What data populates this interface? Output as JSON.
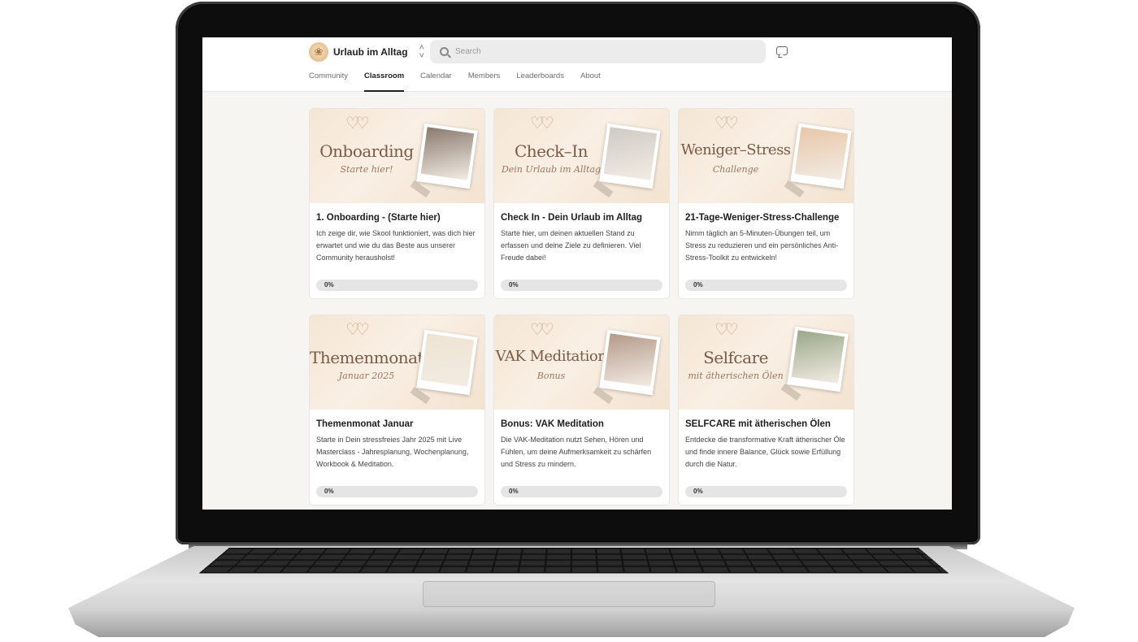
{
  "app": {
    "community_name": "Urlaub im Alltag",
    "search_placeholder": "Search"
  },
  "tabs": [
    {
      "label": "Community",
      "active": false
    },
    {
      "label": "Classroom",
      "active": true
    },
    {
      "label": "Calendar",
      "active": false
    },
    {
      "label": "Members",
      "active": false
    },
    {
      "label": "Leaderboards",
      "active": false
    },
    {
      "label": "About",
      "active": false
    }
  ],
  "courses": [
    {
      "cover_title": "Onboarding",
      "cover_subtitle": "Starte hier!",
      "title": "1. Onboarding - (Starte hier)",
      "description": "Ich zeige dir, wie Skool funktioniert, was dich hier erwartet und wie du das Beste aus unserer Community herausholst!",
      "progress": 0,
      "progress_label": "0%",
      "photo_color": "#8a7a6e"
    },
    {
      "cover_title": "Check–In",
      "cover_subtitle": "Dein Urlaub im Alltag",
      "title": "Check In - Dein Urlaub im Alltag",
      "description": "Starte hier, um deinen aktuellen Stand zu erfassen und deine Ziele zu definieren. Viel Freude dabei!",
      "progress": 0,
      "progress_label": "0%",
      "photo_color": "#cfcac4"
    },
    {
      "cover_title": "Weniger–Stress",
      "cover_subtitle": "Challenge",
      "title": "21-Tage-Weniger-Stress-Challenge",
      "description": "Nimm täglich an 5-Minuten-Übungen teil, um Stress zu reduzieren und ein persönliches Anti-Stress-Toolkit zu entwickeln!",
      "progress": 0,
      "progress_label": "0%",
      "photo_color": "#e8c7a8"
    },
    {
      "cover_title": "Themenmonat",
      "cover_subtitle": "Januar 2025",
      "title": "Themenmonat Januar",
      "description": "Starte in Dein stressfreies Jahr 2025 mit Live Masterclass - Jahresplanung, Wochenplanung, Workbook & Meditation.",
      "progress": 0,
      "progress_label": "0%",
      "photo_color": "#eee3d2"
    },
    {
      "cover_title": "VAK Meditation",
      "cover_subtitle": "Bonus",
      "title": "Bonus: VAK Meditation",
      "description": "Die VAK-Meditation nutzt Sehen, Hören und Fühlen, um deine Aufmerksamkeit zu schärfen und Stress zu mindern.",
      "progress": 0,
      "progress_label": "0%",
      "photo_color": "#b49a8a"
    },
    {
      "cover_title": "Selfcare",
      "cover_subtitle": "mit ätherischen Ölen",
      "title": "SELFCARE mit ätherischen Ölen",
      "description": "Entdecke die transformative Kraft ätherischer Öle und finde innere Balance, Glück sowie Erfüllung durch die Natur.",
      "progress": 0,
      "progress_label": "0%",
      "photo_color": "#9aa888"
    }
  ]
}
